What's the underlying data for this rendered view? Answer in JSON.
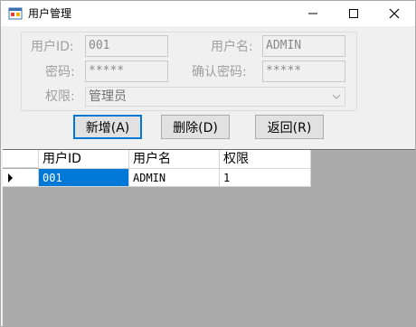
{
  "window": {
    "title": "用户管理",
    "minimize_glyph": "—",
    "maximize_glyph": "☐",
    "close_glyph": "✕"
  },
  "form": {
    "user_id_label": "用户ID:",
    "user_id_value": "001",
    "username_label": "用户名:",
    "username_value": "ADMIN",
    "password_label": "密码:",
    "password_value": "*****",
    "confirm_password_label": "确认密码:",
    "confirm_password_value": "*****",
    "permission_label": "权限:",
    "permission_value": "管理员"
  },
  "buttons": {
    "add": "新增(A)",
    "delete": "删除(D)",
    "back": "返回(R)"
  },
  "grid": {
    "columns": [
      "用户ID",
      "用户名",
      "权限"
    ],
    "rows": [
      [
        "001",
        "ADMIN",
        "1"
      ]
    ]
  },
  "colors": {
    "selection": "#0078d7",
    "grid_background": "#ababab"
  }
}
